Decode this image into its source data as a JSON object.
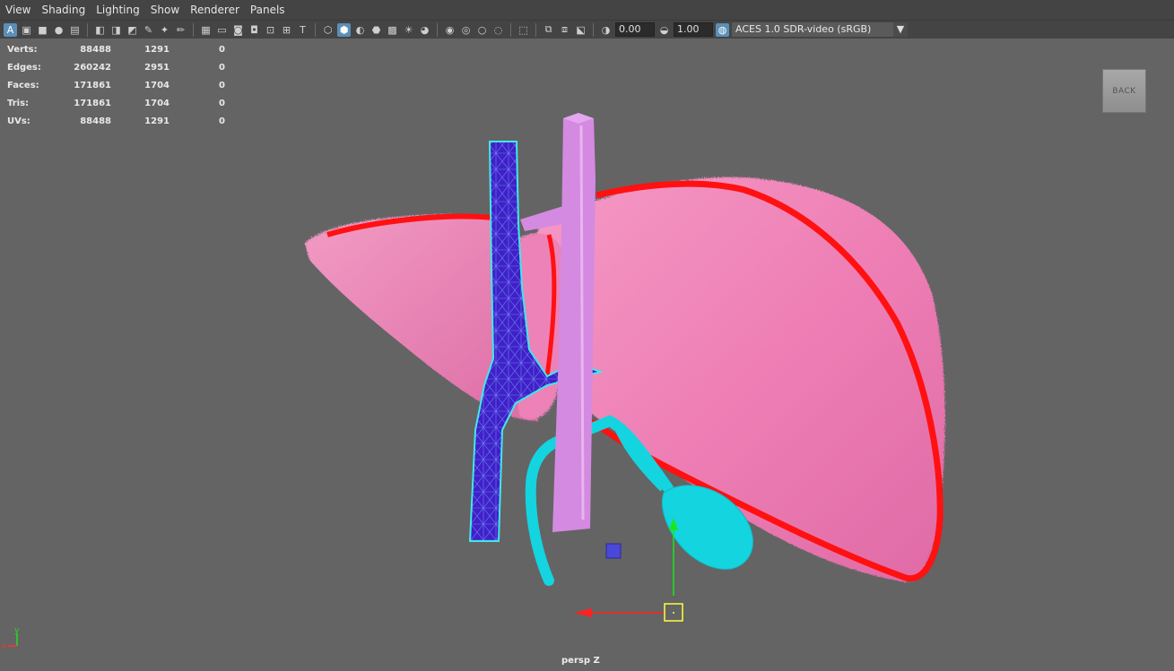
{
  "menu": [
    "View",
    "Shading",
    "Lighting",
    "Show",
    "Renderer",
    "Panels"
  ],
  "toolbar": {
    "exposure_value": "0.00",
    "gamma_value": "1.00",
    "colorspace": "ACES 1.0 SDR-video (sRGB)"
  },
  "hud": {
    "rows": [
      {
        "label": "Verts:",
        "total": "88488",
        "selected": "1291",
        "uv": "0"
      },
      {
        "label": "Edges:",
        "total": "260242",
        "selected": "2951",
        "uv": "0"
      },
      {
        "label": "Faces:",
        "total": "171861",
        "selected": "1704",
        "uv": "0"
      },
      {
        "label": "Tris:",
        "total": "171861",
        "selected": "1704",
        "uv": "0"
      },
      {
        "label": "UVs:",
        "total": "88488",
        "selected": "1291",
        "uv": "0"
      }
    ]
  },
  "back_button": "BACK",
  "camera_label": "persp Z",
  "axis": {
    "y": "y",
    "x": "x"
  },
  "colors": {
    "liver": "#ee7fb5",
    "outline": "#ff1111",
    "vein": "#4020c8",
    "wire": "#40e8e8",
    "artery": "#d48ae0",
    "gallbladder": "#14d4e0",
    "background": "#646464"
  }
}
